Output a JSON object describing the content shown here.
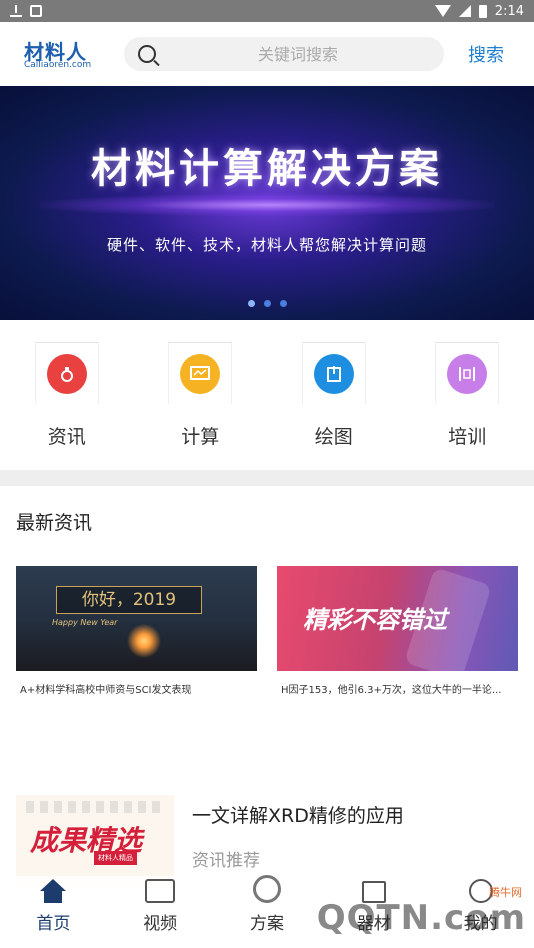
{
  "status_bar": {
    "time": "2:14"
  },
  "header": {
    "logo_main": "材料人",
    "logo_sub": "Cailiaoren.com",
    "search_placeholder": "关键词搜索",
    "search_button": "搜索"
  },
  "banner": {
    "title": "材料计算解决方案",
    "subtitle": "硬件、软件、技术，材料人帮您解决计算问题",
    "dots": 3,
    "active_dot": 0
  },
  "categories": [
    {
      "label": "资讯",
      "icon": "news-icon",
      "color": "#e8413f"
    },
    {
      "label": "计算",
      "icon": "compute-icon",
      "color": "#f5b323"
    },
    {
      "label": "绘图",
      "icon": "draw-icon",
      "color": "#1e8fe0"
    },
    {
      "label": "培训",
      "icon": "training-icon",
      "color": "#c77ee8"
    }
  ],
  "latest_news": {
    "title": "最新资讯",
    "cards": [
      {
        "image_text": "你好，2019",
        "image_sub": "Happy New Year",
        "caption": "A+材料学科高校中师资与SCI发文表现"
      },
      {
        "image_text": "精彩不容错过",
        "caption": "H因子153，他引6.3+万次，这位大牛的一半论..."
      }
    ]
  },
  "featured": {
    "image_text": "成果精选",
    "image_tag": "材料人精品",
    "title": "一文详解XRD精修的应用",
    "tag": "资讯推荐"
  },
  "bottom_nav": [
    {
      "label": "首页",
      "icon": "home-icon",
      "active": true
    },
    {
      "label": "视频",
      "icon": "video-icon",
      "active": false
    },
    {
      "label": "方案",
      "icon": "plan-icon",
      "active": false
    },
    {
      "label": "器材",
      "icon": "device-icon",
      "active": false
    },
    {
      "label": "我的",
      "icon": "profile-icon",
      "active": false
    }
  ],
  "watermark": {
    "text": "QQTN.com",
    "small": "腾牛网"
  }
}
